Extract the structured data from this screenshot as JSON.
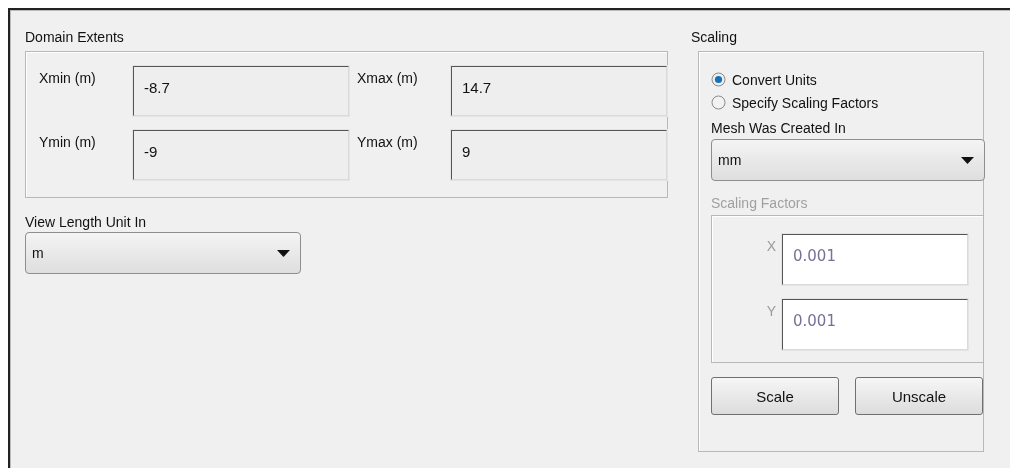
{
  "domain_extents": {
    "title": "Domain Extents",
    "fields": [
      {
        "label": "Xmin (m)",
        "value": "-8.7"
      },
      {
        "label": "Xmax (m)",
        "value": "14.7"
      },
      {
        "label": "Ymin (m)",
        "value": "-9"
      },
      {
        "label": "Ymax (m)",
        "value": "9"
      }
    ]
  },
  "view_length_unit": {
    "label": "View Length Unit In",
    "value": "m"
  },
  "scaling": {
    "title": "Scaling",
    "options": [
      {
        "label": "Convert Units",
        "selected": true
      },
      {
        "label": "Specify Scaling Factors",
        "selected": false
      }
    ],
    "mesh_created_in": {
      "label": "Mesh Was Created In",
      "value": "mm"
    },
    "scaling_factors": {
      "title": "Scaling Factors",
      "disabled": true,
      "fields": [
        {
          "label": "X",
          "value": "0.001"
        },
        {
          "label": "Y",
          "value": "0.001"
        }
      ]
    },
    "buttons": [
      "Scale",
      "Unscale"
    ]
  }
}
